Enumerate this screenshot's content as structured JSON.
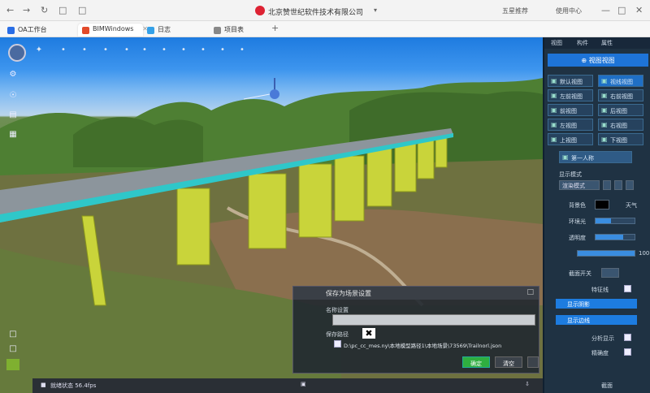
{
  "browser": {
    "title": "北京赞世纪软件技术有限公司",
    "right_items": [
      "五星推荐",
      "使用中心"
    ],
    "tabs": [
      {
        "label": "OA工作台",
        "color": "#2a6ee6"
      },
      {
        "label": "BIMWindows",
        "color": "#e24a2a"
      },
      {
        "label": "日志",
        "color": "#35a1e8"
      },
      {
        "label": "项目表",
        "color": "#888888"
      }
    ]
  },
  "viewport": {
    "toolbar_icons": [
      "home-icon",
      "pointer-icon",
      "measure-icon",
      "rotate-icon",
      "pan-icon",
      "zoom-icon",
      "cut-icon",
      "layer-icon",
      "camera-icon",
      "settings-icon",
      "fullscreen-icon"
    ],
    "left_icons": [
      "gear-icon",
      "compass-icon",
      "layers-icon",
      "grid-icon"
    ]
  },
  "panel": {
    "tabs": [
      "视图",
      "构件",
      "属性"
    ],
    "header": "⊕ 视图视图",
    "view_buttons": [
      {
        "label": "默认视图",
        "selected": false
      },
      {
        "label": "视线视图",
        "selected": true
      },
      {
        "label": "左前视图",
        "selected": false
      },
      {
        "label": "右前视图",
        "selected": false
      },
      {
        "label": "前视图",
        "selected": false
      },
      {
        "label": "后视图",
        "selected": false
      },
      {
        "label": "左视图",
        "selected": false
      },
      {
        "label": "右视图",
        "selected": false
      },
      {
        "label": "上视图",
        "selected": false
      },
      {
        "label": "下视图",
        "selected": false
      }
    ],
    "section_button": "第一人称",
    "display_label": "显示模式",
    "display_mode": "渲染模式",
    "rows": [
      {
        "label": "背景色",
        "extra": "天气"
      },
      {
        "label": "环境光",
        "extra": ""
      },
      {
        "label": "透明度",
        "extra": ""
      },
      {
        "label": "",
        "extra": "100"
      },
      {
        "label": "截面开关",
        "extra": ""
      },
      {
        "label": "特征线",
        "extra": ""
      }
    ],
    "toggles": [
      {
        "label": "显示阴影"
      },
      {
        "label": "显示边线"
      }
    ],
    "bottom_labels": [
      "分析显示",
      "精确度"
    ],
    "bottom_text": "截面"
  },
  "dialog": {
    "title": "保存为场景设置",
    "name_label": "名称设置",
    "path_label": "保存路径",
    "path": "D:\\pc_cc_mes.ny\\本地模型路径1\\本地场景\\73569\\Trailnorl.json",
    "ok": "确定",
    "clear": "清空",
    "cancel": "取消"
  },
  "statusbar": {
    "text": "就绪状态 56.4fps"
  }
}
